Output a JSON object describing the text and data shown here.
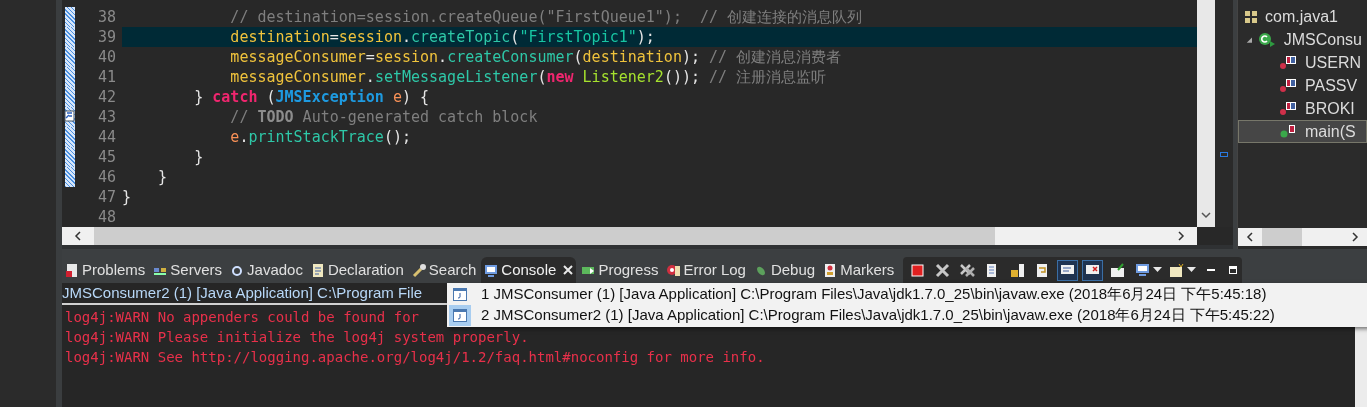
{
  "editor": {
    "lines": [
      {
        "number": "38",
        "changed": true,
        "current": false,
        "segments": [
          {
            "text": "            // destination=session.createQueue(\"FirstQueue1\");  // 创建连接的消息队列",
            "kind": "comment"
          }
        ]
      },
      {
        "number": "39",
        "changed": true,
        "current": true,
        "segments": [
          {
            "text": "            destination",
            "kind": "field"
          },
          {
            "text": "=",
            "kind": "plain"
          },
          {
            "text": "session",
            "kind": "field"
          },
          {
            "text": ".",
            "kind": "plain"
          },
          {
            "text": "createTopic",
            "kind": "method"
          },
          {
            "text": "(",
            "kind": "plain"
          },
          {
            "text": "\"FirstTopic1\"",
            "kind": "string"
          },
          {
            "text": ");",
            "kind": "plain"
          }
        ]
      },
      {
        "number": "40",
        "changed": true,
        "current": false,
        "segments": [
          {
            "text": "            messageConsumer",
            "kind": "field"
          },
          {
            "text": "=",
            "kind": "plain"
          },
          {
            "text": "session",
            "kind": "field"
          },
          {
            "text": ".",
            "kind": "plain"
          },
          {
            "text": "createConsumer",
            "kind": "method"
          },
          {
            "text": "(",
            "kind": "plain"
          },
          {
            "text": "destination",
            "kind": "field"
          },
          {
            "text": "); ",
            "kind": "plain"
          },
          {
            "text": "// 创建消息消费者",
            "kind": "comment"
          }
        ]
      },
      {
        "number": "41",
        "changed": true,
        "current": false,
        "segments": [
          {
            "text": "            messageConsumer",
            "kind": "field"
          },
          {
            "text": ".",
            "kind": "plain"
          },
          {
            "text": "setMessageListener",
            "kind": "method"
          },
          {
            "text": "(",
            "kind": "plain"
          },
          {
            "text": "new",
            "kind": "keyword"
          },
          {
            "text": " Listener2",
            "kind": "type"
          },
          {
            "text": "()); ",
            "kind": "plain"
          },
          {
            "text": "// 注册消息监听",
            "kind": "comment"
          }
        ]
      },
      {
        "number": "42",
        "changed": true,
        "current": false,
        "segments": [
          {
            "text": "        } ",
            "kind": "plain"
          },
          {
            "text": "catch",
            "kind": "keyword"
          },
          {
            "text": " (",
            "kind": "plain"
          },
          {
            "text": "JMSException",
            "kind": "class"
          },
          {
            "text": " e",
            "kind": "param"
          },
          {
            "text": ") {",
            "kind": "plain"
          }
        ]
      },
      {
        "number": "43",
        "changed": true,
        "current": false,
        "task": true,
        "segments": [
          {
            "text": "            // ",
            "kind": "comment"
          },
          {
            "text": "TODO",
            "kind": "todo"
          },
          {
            "text": " Auto-generated catch block",
            "kind": "comment"
          }
        ]
      },
      {
        "number": "44",
        "changed": true,
        "current": false,
        "segments": [
          {
            "text": "            e",
            "kind": "param"
          },
          {
            "text": ".",
            "kind": "plain"
          },
          {
            "text": "printStackTrace",
            "kind": "method"
          },
          {
            "text": "();",
            "kind": "plain"
          }
        ]
      },
      {
        "number": "45",
        "changed": true,
        "current": false,
        "segments": [
          {
            "text": "        }",
            "kind": "plain"
          }
        ]
      },
      {
        "number": "46",
        "changed": true,
        "current": false,
        "segments": [
          {
            "text": "    }",
            "kind": "plain"
          }
        ]
      },
      {
        "number": "47",
        "changed": false,
        "current": false,
        "segments": [
          {
            "text": "}",
            "kind": "plain"
          }
        ]
      },
      {
        "number": "48",
        "changed": false,
        "current": false
      }
    ]
  },
  "outline": {
    "items": [
      {
        "label": "com.java1",
        "kind": "imports",
        "selected": false
      },
      {
        "label": "JMSConsu",
        "kind": "class",
        "selected": false,
        "expanded": true,
        "children": [
          {
            "label": "USERN",
            "kind": "field",
            "selected": false
          },
          {
            "label": "PASSV",
            "kind": "field",
            "selected": false
          },
          {
            "label": "BROKI",
            "kind": "field",
            "selected": false
          },
          {
            "label": "main(S",
            "kind": "method",
            "selected": true
          }
        ]
      }
    ]
  },
  "panel": {
    "tabs": [
      {
        "label": "Problems",
        "kind": "problems",
        "selected": false
      },
      {
        "label": "Servers",
        "kind": "servers",
        "selected": false
      },
      {
        "label": "Javadoc",
        "kind": "javadoc",
        "selected": false
      },
      {
        "label": "Declaration",
        "kind": "declaration",
        "selected": false
      },
      {
        "label": "Search",
        "kind": "search",
        "selected": false
      },
      {
        "label": "Console",
        "kind": "console",
        "selected": true
      },
      {
        "label": "Progress",
        "kind": "progress",
        "selected": false
      },
      {
        "label": "Error Log",
        "kind": "errorlog",
        "selected": false
      },
      {
        "label": "Debug",
        "kind": "debug",
        "selected": false
      },
      {
        "label": "Markers",
        "kind": "markers",
        "selected": false
      }
    ],
    "toolbar": [
      {
        "kind": "terminate",
        "pressed": false
      },
      {
        "kind": "remove",
        "pressed": false
      },
      {
        "kind": "remove-all",
        "pressed": false
      },
      {
        "kind": "clear",
        "pressed": false
      },
      {
        "kind": "scroll-lock",
        "pressed": false
      },
      {
        "kind": "word-wrap",
        "pressed": false
      },
      {
        "kind": "show-out",
        "pressed": true
      },
      {
        "kind": "show-err",
        "pressed": true
      },
      {
        "kind": "pin",
        "pressed": false
      },
      {
        "kind": "display",
        "pressed": false,
        "dropdown": true
      },
      {
        "kind": "open",
        "pressed": false,
        "dropdown": true
      }
    ],
    "console_title": "JMSConsumer2 (1) [Java Application] C:\\Program File",
    "console_lines": [
      "log4j:WARN No appenders could be found for",
      "log4j:WARN Please initialize the log4j system properly.",
      "log4j:WARN See http://logging.apache.org/log4j/1.2/faq.html#noconfig for more info."
    ],
    "menu": [
      {
        "label": "1 JMSConsumer (1) [Java Application] C:\\Program Files\\Java\\jdk1.7.0_25\\bin\\javaw.exe (2018年6月24日 下午5:45:18)",
        "selected": false
      },
      {
        "label": "2 JMSConsumer2 (1) [Java Application] C:\\Program Files\\Java\\jdk1.7.0_25\\bin\\javaw.exe (2018年6月24日 下午5:45:22)",
        "selected": true
      }
    ]
  }
}
